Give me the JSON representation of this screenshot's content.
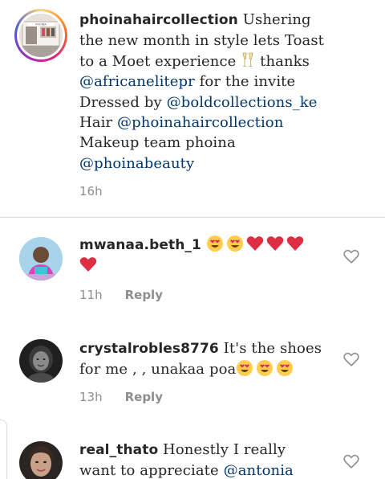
{
  "caption": {
    "username": "phoinahaircollection",
    "line1_text": "Ushering",
    "line2": "the new month in style lets Toast",
    "line3_pre": "to a Moet experience",
    "line3_post": "thanks",
    "mention1": "@africanelitepr",
    "line4_post": "for the invite",
    "line5_pre": "Dressed by",
    "mention2": "@boldcollections_ke",
    "line6_pre": "Hair",
    "mention3": "@phoinahaircollection",
    "line7": "Makeup team phoina",
    "mention4": "@phoinabeauty",
    "time": "16h",
    "avatar_icon": "store-front-avatar",
    "emoji_icon": "champagne-toast-icon"
  },
  "comments": [
    {
      "username": "mwanaa.beth_1",
      "time": "11h",
      "reply": "Reply",
      "emojis": [
        "heart-eyes",
        "heart-eyes",
        "red-heart",
        "red-heart",
        "red-heart",
        "red-heart"
      ]
    },
    {
      "username": "crystalrobles8776",
      "text1": "It's the shoes",
      "text2": "for me , , unakaa poa",
      "time": "13h",
      "reply": "Reply",
      "emojis": [
        "heart-eyes",
        "heart-eyes",
        "heart-eyes"
      ]
    },
    {
      "username": "real_thato",
      "text1": "Honestly I really",
      "text2": "want to appreciate",
      "mention": "@antonia"
    }
  ],
  "colors": {
    "mention": "#00376b",
    "muted": "#8e8e8e",
    "text": "#262626",
    "divider": "#dbdbdb",
    "heart": "#ed1c24",
    "face": "#ffcc4d"
  },
  "icons": {
    "like": "heart-outline-icon"
  }
}
